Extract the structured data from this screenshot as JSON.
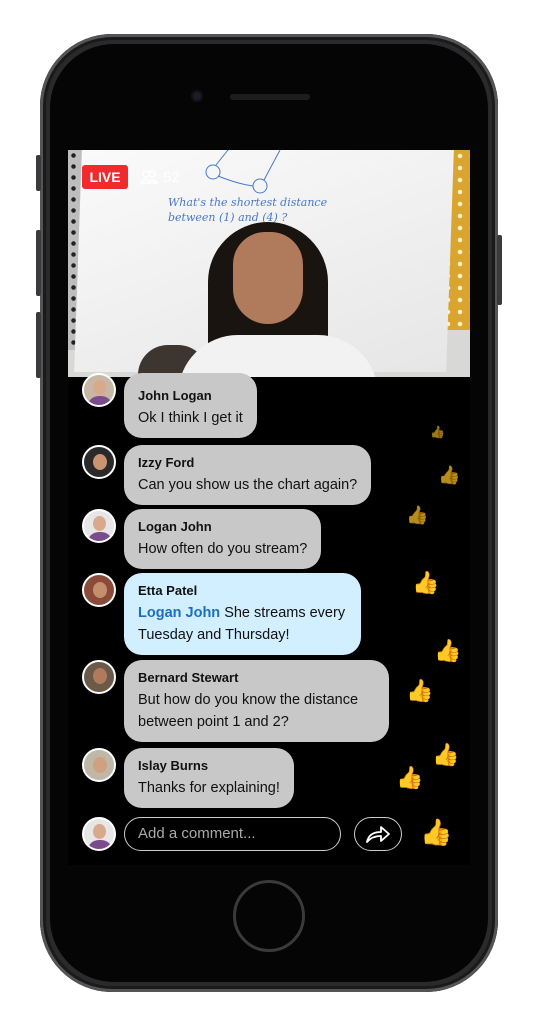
{
  "stream": {
    "live_label": "LIVE",
    "viewer_count": "52",
    "viewers_icon": "people-icon",
    "board_text": [
      "What's the shortest distance",
      "between (1) and (4) ?"
    ]
  },
  "messages": [
    {
      "name": "John Logan",
      "text": "Ok I think I get it"
    },
    {
      "name": "Izzy Ford",
      "text": "Can you show us the chart again?"
    },
    {
      "name": "Logan John",
      "text": "How often do you stream?"
    },
    {
      "name": "Etta Patel",
      "mention": "Logan John",
      "text": " She streams every Tuesday and Thursday!",
      "highlight": "#d2efff"
    },
    {
      "name": "Bernard Stewart",
      "text": "But how do you know the distance between point 1 and 2?"
    },
    {
      "name": "Islay Burns",
      "text": "Thanks for explaining!"
    }
  ],
  "composer": {
    "placeholder": "Add a comment...",
    "share_icon": "share-arrow-icon",
    "like_icon": "thumbs-up-icon"
  },
  "colors": {
    "live": "#ef2b2d",
    "like": "#2b86e3",
    "mention": "#1a6fbf"
  }
}
